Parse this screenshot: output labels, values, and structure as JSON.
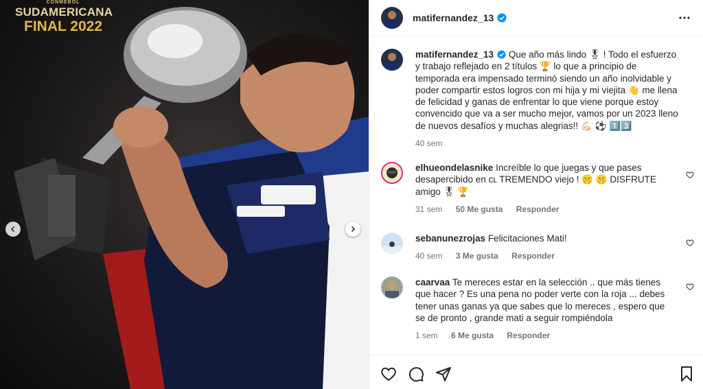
{
  "media": {
    "brand_top": "CONMEBOL",
    "brand_name": "SUDAMERICANA",
    "brand_final": "FINAL 2022",
    "prev_icon": "chevron-left-icon",
    "next_icon": "chevron-right-icon"
  },
  "post": {
    "username": "matifernandez_13",
    "verified_icon": "verified-badge-icon",
    "more_icon": "more-options-icon"
  },
  "caption": {
    "username": "matifernandez_13",
    "text": "Que año más lindo 🎖 ! Todo el esfuerzo y trabajo reflejado en 2 títulos 🏆 lo que a principio de temporada era impensado terminó siendo un año inolvidable y poder compartir estos logros con mi hija y mi viejita 👋 me llena de felicidad y ganas de enfrentar lo que viene porque estoy convencido que va a ser mucho mejor, vamos por un 2023 lleno de nuevos desafíos y muchas alegrias!! 💪🏻 ⚽ 1️⃣3️⃣",
    "time": "40 sem"
  },
  "comments": [
    {
      "username": "elhueondelasnike",
      "text": "Increíble lo que juegas y que pases desapercibido en ᴄʟ TREMENDO viejo ! 🤫 🤫 DISFRUTE amigo 🎖 🏆",
      "time": "31 sem",
      "likes": "50 Me gusta",
      "reply": "Responder"
    },
    {
      "username": "sebanunezrojas",
      "text": "Felicitaciones Mati!",
      "time": "40 sem",
      "likes": "3 Me gusta",
      "reply": "Responder"
    },
    {
      "username": "caarvaa",
      "text": "Te mereces estar en la selección .. que más tienes que hacer ? Es una pena no poder verte con la roja ... debes tener unas ganas ya que sabes que lo mereces , espero que se de pronto , grande mati a seguir rompiéndola",
      "time": "1 sem",
      "likes": "6 Me gusta",
      "reply": "Responder"
    }
  ],
  "actions": {
    "like_icon": "heart-icon",
    "comment_icon": "comment-icon",
    "share_icon": "share-icon",
    "save_icon": "bookmark-icon"
  }
}
